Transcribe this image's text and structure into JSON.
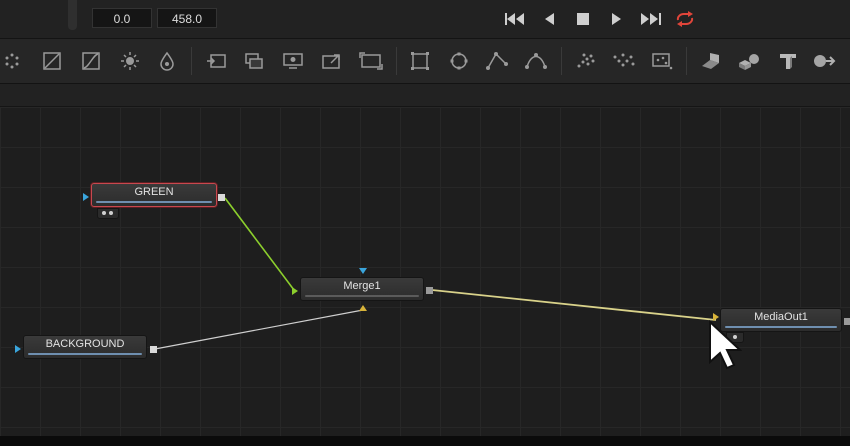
{
  "time_ruler": {
    "start_time": "0.0",
    "end_time": "458.0"
  },
  "transport": {
    "buttons": [
      "skip-to-start",
      "play-reverse",
      "stop",
      "play-forward",
      "skip-to-end",
      "loop"
    ],
    "loop_color": "#e0453a"
  },
  "toolbar": {
    "tools": [
      "particles",
      "color-corrector",
      "curves",
      "brightness-contrast",
      "blur",
      "loader",
      "merge-layers",
      "media-out",
      "transform",
      "resize",
      "rectangle-mask",
      "ellipse-mask",
      "polygon-mask",
      "bspline-mask",
      "pemitter",
      "prender",
      "pimage",
      "shape-3d",
      "merge-3d",
      "text-3d",
      "renderer-3d"
    ]
  },
  "flow": {
    "nodes": [
      {
        "id": "green",
        "label": "GREEN",
        "selected": true
      },
      {
        "id": "merge1",
        "label": "Merge1",
        "selected": false
      },
      {
        "id": "background",
        "label": "BACKGROUND",
        "selected": false
      },
      {
        "id": "mediaout1",
        "label": "MediaOut1",
        "selected": false
      }
    ],
    "connections": [
      {
        "from": "GREEN",
        "to": "Merge1",
        "input": "foreground",
        "color": "#8ccf2d"
      },
      {
        "from": "BACKGROUND",
        "to": "Merge1",
        "input": "background",
        "color": "#cfcfcf"
      },
      {
        "from": "Merge1",
        "to": "MediaOut1",
        "input": "input",
        "color": "#d9d28a"
      }
    ],
    "selection_color": "#c8484e",
    "grid_color": "#272727"
  }
}
